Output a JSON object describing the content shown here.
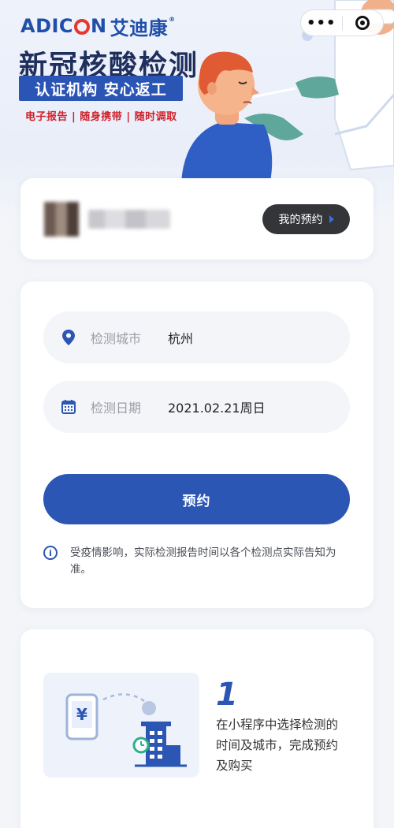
{
  "brand": {
    "logo_en_prefix": "ADIC",
    "logo_en_suffix": "N",
    "logo_cn": "艾迪康"
  },
  "banner": {
    "title": "新冠核酸检测",
    "slogan": "认证机构  安心返工",
    "features": "电子报告 | 随身携带 | 随时调取"
  },
  "capsule": {
    "more_label": "•••",
    "close_icon": "target-circle-icon"
  },
  "user": {
    "my_orders_label": "我的预约"
  },
  "form": {
    "city_label": "检测城市",
    "city_value": "杭州",
    "date_label": "检测日期",
    "date_value": "2021.02.21周日",
    "book_label": "预约",
    "notice": "受疫情影响，实际检测报告时间以各个检测点实际告知为准。"
  },
  "step": {
    "number": "1",
    "text": "在小程序中选择检测的时间及城市，完成预约及购买",
    "phone_symbol": "¥"
  },
  "colors": {
    "primary": "#2c56b3",
    "title_dark": "#1f2f5c",
    "feature_red": "#d0202b",
    "button_dark": "#333538"
  }
}
